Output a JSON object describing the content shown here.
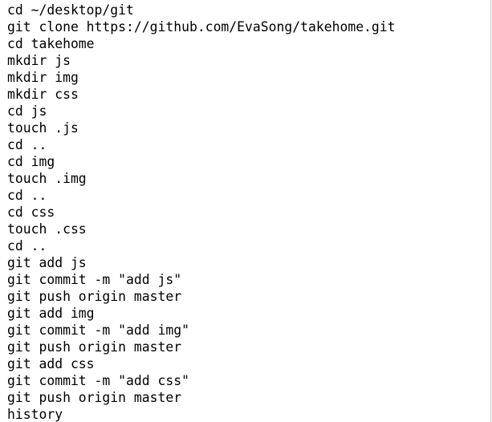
{
  "terminal": {
    "lines": [
      "cd ~/desktop/git",
      "git clone https://github.com/EvaSong/takehome.git",
      "cd takehome",
      "mkdir js",
      "mkdir img",
      "mkdir css",
      "cd js",
      "touch .js",
      "cd ..",
      "cd img",
      "touch .img",
      "cd ..",
      "cd css",
      "touch .css",
      "cd ..",
      "git add js",
      "git commit -m \"add js\"",
      "git push origin master",
      "git add img",
      "git commit -m \"add img\"",
      "git push origin master",
      "git add css",
      "git commit -m \"add css\"",
      "git push origin master",
      "history"
    ]
  }
}
